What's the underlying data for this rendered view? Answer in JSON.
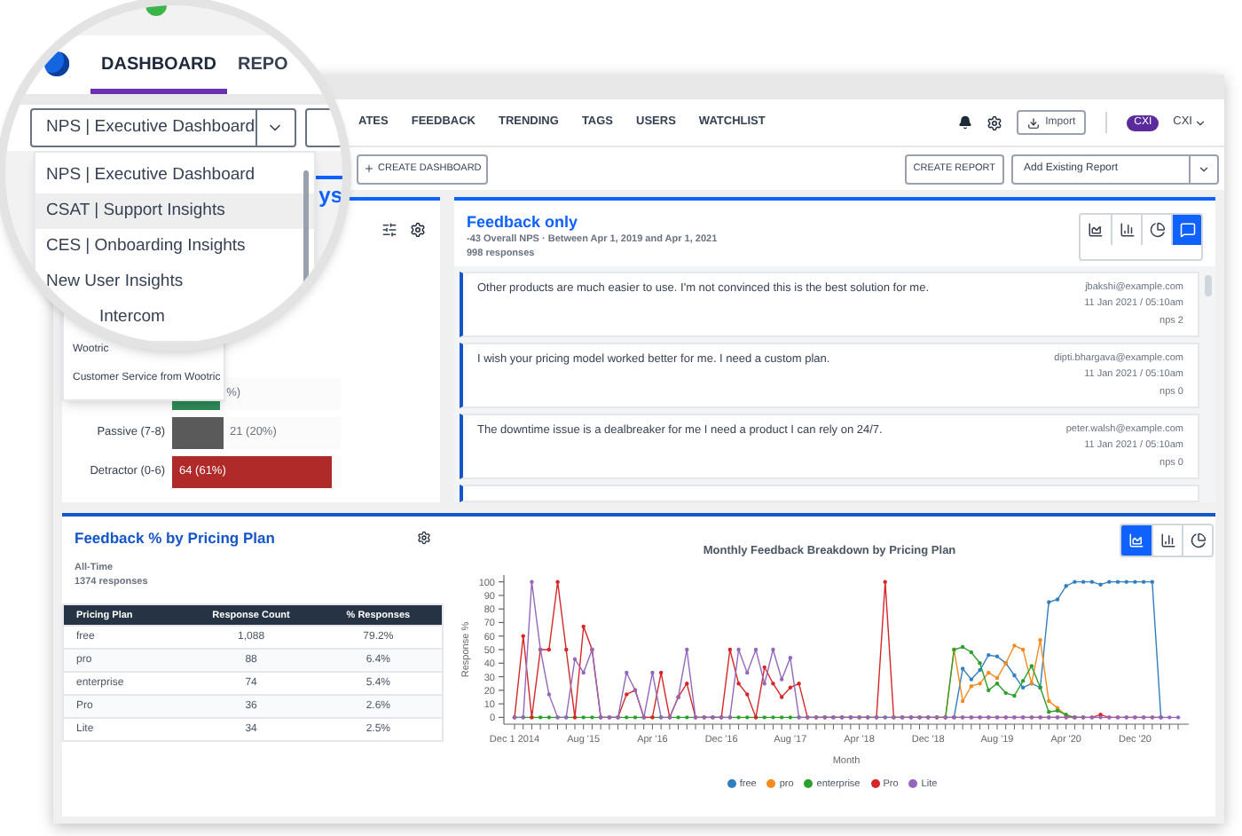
{
  "loupe": {
    "tabs": [
      {
        "label": "DASHBOARD",
        "selected": true
      },
      {
        "label": "REPO",
        "selected": false
      }
    ],
    "dashboard_select": {
      "value": "NPS | Executive Dashboard"
    },
    "options": [
      {
        "label": "NPS | Executive Dashboard",
        "selected": false
      },
      {
        "label": "CSAT | Support Insights",
        "selected": true
      },
      {
        "label": "CES | Onboarding Insights",
        "selected": false
      },
      {
        "label": "New User Insights",
        "selected": false
      },
      {
        "label": "Intercom",
        "selected": false
      }
    ],
    "panel_title": "ys"
  },
  "nav": {
    "items": [
      "ATES",
      "FEEDBACK",
      "TRENDING",
      "TAGS",
      "USERS",
      "WATCHLIST"
    ],
    "import_button": "Import",
    "account_badge": "CXI",
    "account_name": "CXI"
  },
  "toolbar": {
    "create_dashboard": "CREATE DASHBOARD",
    "create_report": "CREATE REPORT",
    "add_report_select": "Add Existing Report"
  },
  "dropdown_items": [
    "Wootric",
    "Customer Service from Wootric"
  ],
  "nps_panel": {
    "rows": [
      {
        "kind": "outside",
        "reading": "%)",
        "level": 0.28,
        "color": "#2e8b57"
      },
      {
        "kind": "outside",
        "label": "Passive (7-8)",
        "reading": "21 (20%)",
        "level": 0.3,
        "color": "#5a5a5a"
      },
      {
        "kind": "inside",
        "label": "Detractor (0-6)",
        "reading": "64 (61%)",
        "level": 0.95,
        "color": "#b02a2a"
      }
    ]
  },
  "feedback_panel": {
    "title": "Feedback only",
    "subtitle": "-43 Overall NPS · Between Apr 1, 2019 and Apr 1, 2021",
    "count": "998 responses",
    "view_buttons": [
      {
        "kind": "area",
        "selected": false
      },
      {
        "kind": "bar",
        "selected": false
      },
      {
        "kind": "pie",
        "selected": false
      },
      {
        "kind": "comment",
        "selected": true
      }
    ],
    "responses": [
      {
        "text": "Other products are much easier to use. I'm not convinced this is the best solution for me.",
        "email": "jbakshi@example.com",
        "date": "11 Jan 2021 / 05:10am",
        "score": "nps 2"
      },
      {
        "text": "I wish your pricing model worked better for me. I need a custom plan.",
        "email": "dipti.bhargava@example.com",
        "date": "11 Jan 2021 / 05:10am",
        "score": "nps 0"
      },
      {
        "text": "The downtime issue is a dealbreaker for me I need a product I can rely on 24/7.",
        "email": "peter.walsh@example.com",
        "date": "11 Jan 2021 / 05:10am",
        "score": "nps 0"
      }
    ]
  },
  "pricing_panel": {
    "title": "Feedback % by Pricing Plan",
    "period": "All-Time",
    "count": "1374 responses",
    "table": {
      "columns": [
        "Pricing Plan",
        "Response Count",
        "% Responses"
      ],
      "rows": [
        [
          "free",
          "1,088",
          "79.2%"
        ],
        [
          "pro",
          "88",
          "6.4%"
        ],
        [
          "enterprise",
          "74",
          "5.4%"
        ],
        [
          "Pro",
          "36",
          "2.6%"
        ],
        [
          "Lite",
          "34",
          "2.5%"
        ]
      ]
    },
    "view_buttons": [
      {
        "kind": "area",
        "selected": true
      },
      {
        "kind": "bar",
        "selected": false
      },
      {
        "kind": "pie",
        "selected": false
      }
    ],
    "chart_data": {
      "type": "line",
      "title": "Monthly Feedback Breakdown by Pricing Plan",
      "xlabel": "Month",
      "ylabel": "Response %",
      "categories": [
        "Dec 1 2014",
        null,
        null,
        null,
        null,
        null,
        null,
        null,
        "Aug '15",
        null,
        null,
        null,
        null,
        null,
        null,
        null,
        "Apr '16",
        null,
        null,
        null,
        null,
        null,
        null,
        null,
        "Dec '16",
        null,
        null,
        null,
        null,
        null,
        null,
        null,
        "Aug '17",
        null,
        null,
        null,
        null,
        null,
        null,
        null,
        "Apr '18",
        null,
        null,
        null,
        null,
        null,
        null,
        null,
        "Dec '18",
        null,
        null,
        null,
        null,
        null,
        null,
        null,
        "Aug '19",
        null,
        null,
        null,
        null,
        null,
        null,
        null,
        "Apr '20",
        null,
        null,
        null,
        null,
        null,
        null,
        null,
        "Dec '20",
        null,
        null,
        null,
        null,
        null
      ],
      "ylim": [
        -5,
        105
      ],
      "legend": "bottom",
      "yticks": [
        0,
        10,
        20,
        30,
        40,
        50,
        60,
        70,
        80,
        90,
        100
      ],
      "series": [
        {
          "name": "free",
          "color": "#2f7fc1",
          "values": [
            null,
            null,
            null,
            null,
            null,
            null,
            null,
            null,
            null,
            null,
            null,
            null,
            null,
            null,
            null,
            null,
            null,
            null,
            null,
            null,
            null,
            null,
            null,
            null,
            null,
            null,
            null,
            null,
            null,
            null,
            null,
            null,
            null,
            null,
            null,
            null,
            null,
            null,
            null,
            null,
            null,
            null,
            null,
            null,
            null,
            null,
            null,
            null,
            null,
            null,
            null,
            0,
            36,
            28,
            35,
            46,
            45,
            40,
            31,
            22,
            25,
            22,
            85,
            87,
            97,
            100,
            100,
            100,
            98,
            100,
            100,
            100,
            100,
            100,
            100,
            0,
            null,
            null
          ]
        },
        {
          "name": "pro",
          "color": "#f58a1f",
          "values": [
            null,
            null,
            null,
            null,
            null,
            null,
            null,
            null,
            null,
            null,
            null,
            null,
            null,
            null,
            null,
            null,
            null,
            null,
            null,
            null,
            null,
            null,
            null,
            null,
            null,
            null,
            null,
            null,
            null,
            null,
            null,
            null,
            null,
            null,
            null,
            null,
            null,
            null,
            null,
            null,
            null,
            null,
            null,
            null,
            null,
            null,
            null,
            null,
            null,
            null,
            0,
            50,
            12,
            23,
            25,
            33,
            29,
            40,
            53,
            50,
            25,
            57,
            12,
            7,
            1,
            0,
            null,
            null,
            null,
            null,
            null,
            null,
            null,
            null,
            null,
            null,
            null,
            null
          ]
        },
        {
          "name": "enterprise",
          "color": "#2ca02c",
          "values": [
            0,
            0,
            0,
            0,
            0,
            0,
            0,
            0,
            0,
            0,
            0,
            0,
            0,
            0,
            0,
            0,
            0,
            0,
            0,
            0,
            0,
            0,
            0,
            0,
            0,
            0,
            0,
            0,
            0,
            0,
            0,
            0,
            0,
            0,
            0,
            0,
            0,
            0,
            0,
            0,
            0,
            0,
            0,
            0,
            0,
            0,
            0,
            0,
            0,
            0,
            0,
            50,
            52,
            48,
            40,
            20,
            25,
            18,
            16,
            27,
            38,
            22,
            4,
            5,
            2,
            0,
            0,
            null,
            null,
            null,
            null,
            null,
            null,
            null,
            null,
            null,
            null,
            null
          ]
        },
        {
          "name": "Pro",
          "color": "#d62728",
          "values": [
            0,
            60,
            0,
            50,
            50,
            100,
            50,
            0,
            67,
            50,
            0,
            0,
            0,
            17,
            20,
            0,
            0,
            33,
            0,
            15,
            25,
            0,
            0,
            0,
            0,
            50,
            25,
            17,
            0,
            37,
            25,
            15,
            22,
            25,
            0,
            0,
            0,
            0,
            0,
            0,
            0,
            0,
            0,
            100,
            0,
            0,
            0,
            0,
            0,
            0,
            0,
            0,
            0,
            0,
            0,
            0,
            0,
            0,
            0,
            0,
            0,
            0,
            0,
            0,
            0,
            0,
            0,
            0,
            2,
            0,
            0,
            0,
            0,
            0,
            0,
            0,
            null,
            null
          ]
        },
        {
          "name": "Lite",
          "color": "#9467bd",
          "values": [
            0,
            0,
            100,
            50,
            17,
            0,
            0,
            43,
            33,
            50,
            0,
            0,
            0,
            33,
            20,
            0,
            33,
            0,
            0,
            15,
            50,
            0,
            0,
            0,
            0,
            0,
            50,
            33,
            50,
            25,
            50,
            28,
            44,
            0,
            0,
            0,
            0,
            0,
            0,
            0,
            0,
            0,
            0,
            0,
            0,
            0,
            0,
            0,
            0,
            0,
            0,
            0,
            0,
            0,
            0,
            0,
            0,
            0,
            0,
            0,
            0,
            0,
            0,
            0,
            0,
            0,
            0,
            0,
            0,
            0,
            0,
            0,
            0,
            0,
            0,
            0,
            0,
            0
          ]
        }
      ]
    }
  }
}
